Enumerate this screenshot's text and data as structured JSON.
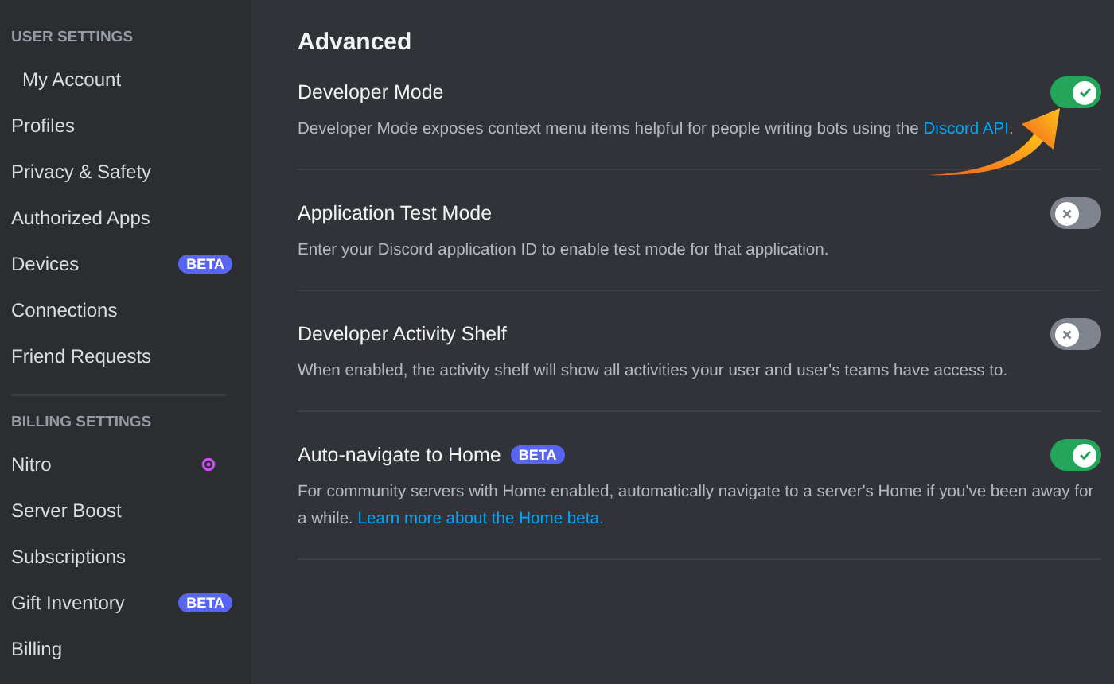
{
  "sidebar": {
    "sections": [
      {
        "heading": "USER SETTINGS",
        "items": [
          {
            "label": "My Account",
            "selected": false,
            "indent": true
          },
          {
            "label": "Profiles",
            "selected": false
          },
          {
            "label": "Privacy & Safety",
            "selected": false
          },
          {
            "label": "Authorized Apps",
            "selected": false
          },
          {
            "label": "Devices",
            "selected": false,
            "badge": "BETA"
          },
          {
            "label": "Connections",
            "selected": false
          },
          {
            "label": "Friend Requests",
            "selected": false
          }
        ]
      },
      {
        "heading": "BILLING SETTINGS",
        "items": [
          {
            "label": "Nitro",
            "selected": false,
            "kind": "nitro"
          },
          {
            "label": "Server Boost",
            "selected": false
          },
          {
            "label": "Subscriptions",
            "selected": false
          },
          {
            "label": "Gift Inventory",
            "selected": false,
            "badge": "BETA"
          },
          {
            "label": "Billing",
            "selected": false
          }
        ]
      }
    ]
  },
  "main": {
    "title": "Advanced",
    "settings": [
      {
        "title": "Developer Mode",
        "on": true,
        "description": "Developer Mode exposes context menu items helpful for people writing bots using the ",
        "link": "Discord API",
        "after": "."
      },
      {
        "title": "Application Test Mode",
        "on": false,
        "description": "Enter your Discord application ID to enable test mode for that application."
      },
      {
        "title": "Developer Activity Shelf",
        "on": false,
        "description": "When enabled, the activity shelf will show all activities your user and user's teams have access to."
      },
      {
        "title": "Auto-navigate to Home",
        "badge": "BETA",
        "on": true,
        "description": "For community servers with Home enabled, automatically navigate to a server's Home if you've been away for a while. ",
        "link": "Learn more about the Home beta."
      }
    ]
  }
}
